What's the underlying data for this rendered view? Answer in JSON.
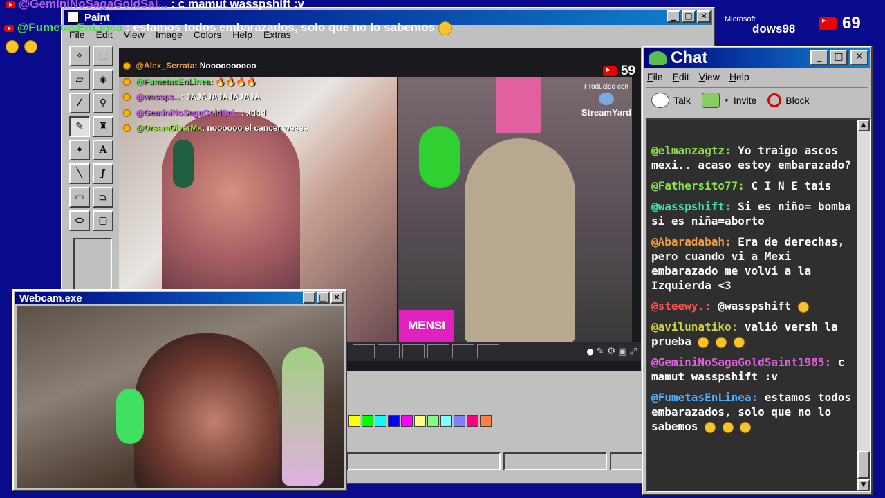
{
  "overlay": {
    "line1_user": "@GeminiNoSagaGoldSai...",
    "line1_text": ": c mamut wasspshift :v",
    "line2_user": "@FumetasEnLinea",
    "line2_text": ": estamos todos embarazados, solo que no lo sabemos",
    "subscriber_count": "69",
    "os_brand_top": "Microsoft",
    "os_brand": "dows98"
  },
  "paint": {
    "title": "Paint",
    "menu": [
      "File",
      "Edit",
      "View",
      "Image",
      "Colors",
      "Help",
      "Extras"
    ],
    "palette": [
      "#ffff00",
      "#00ff00",
      "#00ffff",
      "#0000ff",
      "#ff00ff",
      "#ffff80",
      "#80ff80",
      "#80ffff",
      "#8080ff",
      "#ff0080",
      "#ff8040"
    ]
  },
  "stream": {
    "viewer_count": "59",
    "producer_label": "Producido con",
    "producer_name": "StreamYard",
    "name_tag": "MENSI",
    "chat": [
      {
        "user": "@Alex_Serrata",
        "text": ": Noooooooooo",
        "color": "#f0a040"
      },
      {
        "user": "@FumetasEnLinea",
        "text": ": 🔥🔥🔥🔥",
        "color": "#50e050"
      },
      {
        "user": "@wassps...",
        "text": ": JAJAJAJAJAJAJA",
        "color": "#c060e0"
      },
      {
        "user": "@GeminiNoSagaGoldSai...",
        "text": ": xddd",
        "color": "#c060e0"
      },
      {
        "user": "@DreamDiverMx",
        "text": ": noooooo el cancer weeee",
        "color": "#a0e050"
      }
    ]
  },
  "webcam": {
    "title": "Webcam.exe"
  },
  "chat_window": {
    "title": "Chat",
    "menu": [
      "File",
      "Edit",
      "View",
      "Help"
    ],
    "toolbar": {
      "talk": "Talk",
      "invite": "Invite",
      "block": "Block"
    },
    "messages": [
      {
        "user": "@elmanzagtz:",
        "text": "Yo traigo ascos mexi.. acaso estoy embarazado?",
        "color": "#8de04a",
        "emoji": 0
      },
      {
        "user": "@Fathersito77:",
        "text": "C I N E tais",
        "color": "#8de04a",
        "emoji": 0
      },
      {
        "user": "@wasspshift:",
        "text": "Si es niño= bomba si es niña=aborto",
        "color": "#40e0b0",
        "emoji": 0
      },
      {
        "user": "@Abaradabah:",
        "text": "Era de derechas, pero cuando vi a Mexi embarazado me volví a la Izquierda <3",
        "color": "#f0a040",
        "emoji": 0
      },
      {
        "user": "@steewy.:",
        "text": "@wasspshift",
        "color": "#ff5050",
        "emoji": 1
      },
      {
        "user": "@avilunatiko:",
        "text": "valió versh la prueba",
        "color": "#d0d040",
        "emoji": 3
      },
      {
        "user": "@GeminiNoSagaGoldSaint1985:",
        "text": "c mamut wasspshift :v",
        "color": "#e060e0",
        "emoji": 0
      },
      {
        "user": "@FumetasEnLinea:",
        "text": "estamos todos embarazados, solo que no lo sabemos",
        "color": "#50b0ff",
        "emoji": 3
      }
    ]
  }
}
